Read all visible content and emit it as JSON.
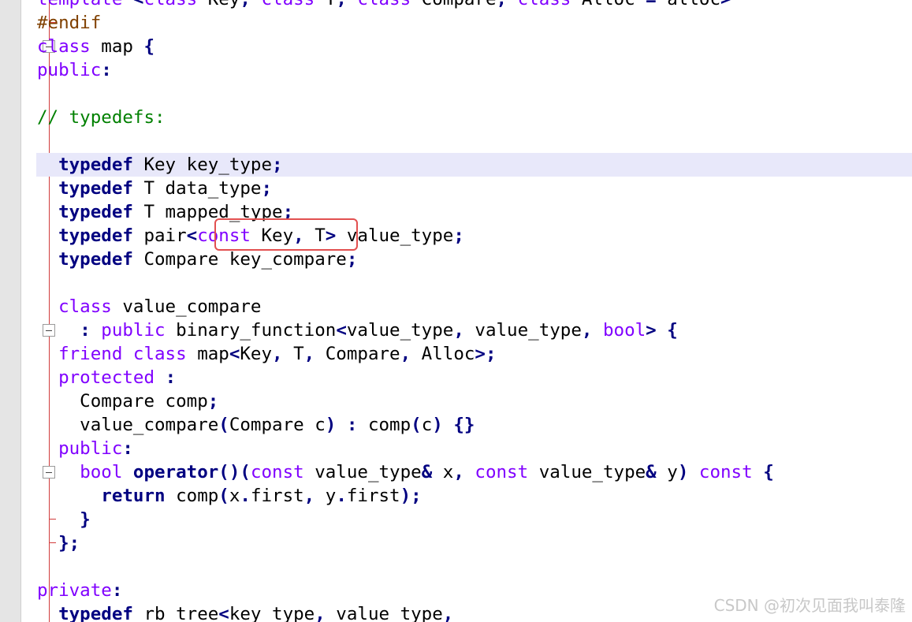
{
  "code_lines": [
    {
      "line": 1,
      "tokens": [
        {
          "t": "template",
          "c": "kw"
        },
        {
          "t": " "
        },
        {
          "t": "<",
          "c": "op"
        },
        {
          "t": "class",
          "c": "kw"
        },
        {
          "t": " Key"
        },
        {
          "t": ",",
          "c": "op"
        },
        {
          "t": " "
        },
        {
          "t": "class",
          "c": "kw"
        },
        {
          "t": " T"
        },
        {
          "t": ",",
          "c": "op"
        },
        {
          "t": " "
        },
        {
          "t": "class",
          "c": "kw"
        },
        {
          "t": " Compare"
        },
        {
          "t": ",",
          "c": "op"
        },
        {
          "t": " "
        },
        {
          "t": "class",
          "c": "kw"
        },
        {
          "t": " Alloc "
        },
        {
          "t": "=",
          "c": "op"
        },
        {
          "t": " alloc"
        },
        {
          "t": ">",
          "c": "op"
        }
      ]
    },
    {
      "line": 2,
      "tokens": [
        {
          "t": "#endif",
          "c": "pp"
        }
      ]
    },
    {
      "line": 3,
      "tokens": [
        {
          "t": "class",
          "c": "kw"
        },
        {
          "t": " map "
        },
        {
          "t": "{",
          "c": "op"
        }
      ]
    },
    {
      "line": 4,
      "tokens": [
        {
          "t": "public",
          "c": "kw"
        },
        {
          "t": ":",
          "c": "op"
        }
      ]
    },
    {
      "line": 5,
      "tokens": []
    },
    {
      "line": 6,
      "tokens": [
        {
          "t": "// typedefs:",
          "c": "cm"
        }
      ]
    },
    {
      "line": 7,
      "tokens": []
    },
    {
      "line": 8,
      "tokens": [
        {
          "t": "  "
        },
        {
          "t": "typedef",
          "c": "kwb"
        },
        {
          "t": " Key key_type"
        },
        {
          "t": ";",
          "c": "op"
        }
      ]
    },
    {
      "line": 9,
      "tokens": [
        {
          "t": "  "
        },
        {
          "t": "typedef",
          "c": "kwb"
        },
        {
          "t": " T data_type"
        },
        {
          "t": ";",
          "c": "op"
        }
      ]
    },
    {
      "line": 10,
      "tokens": [
        {
          "t": "  "
        },
        {
          "t": "typedef",
          "c": "kwb"
        },
        {
          "t": " T mapped_type"
        },
        {
          "t": ";",
          "c": "op"
        }
      ]
    },
    {
      "line": 11,
      "tokens": [
        {
          "t": "  "
        },
        {
          "t": "typedef",
          "c": "kwb"
        },
        {
          "t": " pair"
        },
        {
          "t": "<",
          "c": "op"
        },
        {
          "t": "const",
          "c": "kw"
        },
        {
          "t": " Key"
        },
        {
          "t": ",",
          "c": "op"
        },
        {
          "t": " T"
        },
        {
          "t": ">",
          "c": "op"
        },
        {
          "t": " value_type"
        },
        {
          "t": ";",
          "c": "op"
        }
      ]
    },
    {
      "line": 12,
      "tokens": [
        {
          "t": "  "
        },
        {
          "t": "typedef",
          "c": "kwb"
        },
        {
          "t": " Compare key_compare"
        },
        {
          "t": ";",
          "c": "op"
        }
      ]
    },
    {
      "line": 13,
      "tokens": []
    },
    {
      "line": 14,
      "tokens": [
        {
          "t": "  "
        },
        {
          "t": "class",
          "c": "kw"
        },
        {
          "t": " value_compare"
        }
      ]
    },
    {
      "line": 15,
      "tokens": [
        {
          "t": "    "
        },
        {
          "t": ":",
          "c": "op"
        },
        {
          "t": " "
        },
        {
          "t": "public",
          "c": "kw"
        },
        {
          "t": " binary_function"
        },
        {
          "t": "<",
          "c": "op"
        },
        {
          "t": "value_type"
        },
        {
          "t": ",",
          "c": "op"
        },
        {
          "t": " value_type"
        },
        {
          "t": ",",
          "c": "op"
        },
        {
          "t": " "
        },
        {
          "t": "bool",
          "c": "kw"
        },
        {
          "t": ">",
          "c": "op"
        },
        {
          "t": " "
        },
        {
          "t": "{",
          "c": "op"
        }
      ]
    },
    {
      "line": 16,
      "tokens": [
        {
          "t": "  "
        },
        {
          "t": "friend",
          "c": "kw"
        },
        {
          "t": " "
        },
        {
          "t": "class",
          "c": "kw"
        },
        {
          "t": " map"
        },
        {
          "t": "<",
          "c": "op"
        },
        {
          "t": "Key"
        },
        {
          "t": ",",
          "c": "op"
        },
        {
          "t": " T"
        },
        {
          "t": ",",
          "c": "op"
        },
        {
          "t": " Compare"
        },
        {
          "t": ",",
          "c": "op"
        },
        {
          "t": " Alloc"
        },
        {
          "t": ">;",
          "c": "op"
        }
      ]
    },
    {
      "line": 17,
      "tokens": [
        {
          "t": "  "
        },
        {
          "t": "protected",
          "c": "kw"
        },
        {
          "t": " "
        },
        {
          "t": ":",
          "c": "op"
        }
      ]
    },
    {
      "line": 18,
      "tokens": [
        {
          "t": "    Compare comp"
        },
        {
          "t": ";",
          "c": "op"
        }
      ]
    },
    {
      "line": 19,
      "tokens": [
        {
          "t": "    value_compare"
        },
        {
          "t": "(",
          "c": "op"
        },
        {
          "t": "Compare c"
        },
        {
          "t": ")",
          "c": "op"
        },
        {
          "t": " "
        },
        {
          "t": ":",
          "c": "op"
        },
        {
          "t": " comp"
        },
        {
          "t": "(",
          "c": "op"
        },
        {
          "t": "c"
        },
        {
          "t": ")",
          "c": "op"
        },
        {
          "t": " "
        },
        {
          "t": "{}",
          "c": "op"
        }
      ]
    },
    {
      "line": 20,
      "tokens": [
        {
          "t": "  "
        },
        {
          "t": "public",
          "c": "kw"
        },
        {
          "t": ":",
          "c": "op"
        }
      ]
    },
    {
      "line": 21,
      "tokens": [
        {
          "t": "    "
        },
        {
          "t": "bool",
          "c": "kw"
        },
        {
          "t": " "
        },
        {
          "t": "operator",
          "c": "kwb"
        },
        {
          "t": "()(",
          "c": "op"
        },
        {
          "t": "const",
          "c": "kw"
        },
        {
          "t": " value_type"
        },
        {
          "t": "&",
          "c": "op"
        },
        {
          "t": " x"
        },
        {
          "t": ",",
          "c": "op"
        },
        {
          "t": " "
        },
        {
          "t": "const",
          "c": "kw"
        },
        {
          "t": " value_type"
        },
        {
          "t": "&",
          "c": "op"
        },
        {
          "t": " y"
        },
        {
          "t": ")",
          "c": "op"
        },
        {
          "t": " "
        },
        {
          "t": "const",
          "c": "kw"
        },
        {
          "t": " "
        },
        {
          "t": "{",
          "c": "op"
        }
      ]
    },
    {
      "line": 22,
      "tokens": [
        {
          "t": "      "
        },
        {
          "t": "return",
          "c": "kwb"
        },
        {
          "t": " comp"
        },
        {
          "t": "(",
          "c": "op"
        },
        {
          "t": "x"
        },
        {
          "t": ".",
          "c": "op"
        },
        {
          "t": "first"
        },
        {
          "t": ",",
          "c": "op"
        },
        {
          "t": " y"
        },
        {
          "t": ".",
          "c": "op"
        },
        {
          "t": "first"
        },
        {
          "t": ");",
          "c": "op"
        }
      ]
    },
    {
      "line": 23,
      "tokens": [
        {
          "t": "    "
        },
        {
          "t": "}",
          "c": "op"
        }
      ]
    },
    {
      "line": 24,
      "tokens": [
        {
          "t": "  "
        },
        {
          "t": "};",
          "c": "op"
        }
      ]
    },
    {
      "line": 25,
      "tokens": []
    },
    {
      "line": 26,
      "tokens": [
        {
          "t": "private",
          "c": "kw"
        },
        {
          "t": ":",
          "c": "op"
        }
      ]
    },
    {
      "line": 27,
      "tokens": [
        {
          "t": "  "
        },
        {
          "t": "typedef",
          "c": "kwb"
        },
        {
          "t": " rb_tree"
        },
        {
          "t": "<",
          "c": "op"
        },
        {
          "t": "key_type"
        },
        {
          "t": ",",
          "c": "op"
        },
        {
          "t": " value_type"
        },
        {
          "t": ",",
          "c": "op"
        }
      ]
    }
  ],
  "token_colors": {
    "keyword": "#8000ff",
    "keyword_bold": "#000080",
    "operator": "#000080",
    "comment": "#008000",
    "preprocessor": "#804000",
    "plain": "#000000",
    "current_line_background": "#e8e8fa",
    "annotation_border": "#e25050",
    "fold_line": "#d13b3b"
  },
  "highlighted_line": 8,
  "annotation": {
    "target_line": 11,
    "target_text": "<const Key,",
    "style": "red-rounded-rectangle"
  },
  "fold_markers": [
    {
      "line": 3,
      "icon": "fold-minus-icon"
    },
    {
      "line": 15,
      "icon": "fold-minus-icon"
    },
    {
      "line": 21,
      "icon": "fold-minus-icon"
    }
  ],
  "watermark": {
    "text": "CSDN @初次见面我叫泰隆"
  }
}
